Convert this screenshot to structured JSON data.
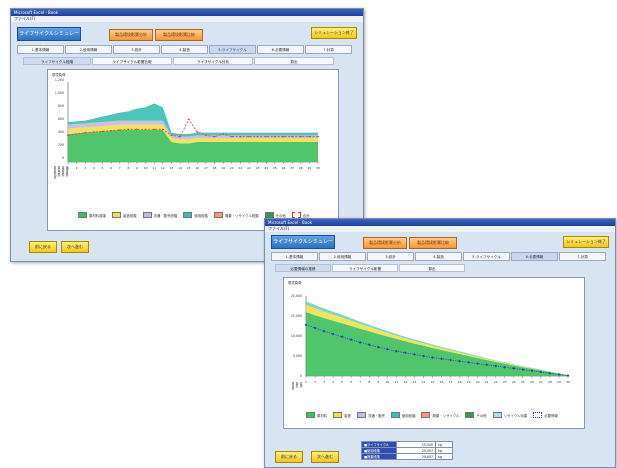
{
  "window1": {
    "title": "Microsoft Excel - Book",
    "menu": "ファイル(F)",
    "app_button": "ライフサイクルシミュレーション",
    "mid_buttons": [
      "製品環境影響分析",
      "製品環境影響比較"
    ],
    "right_button": "シミュレーション終了",
    "tabs": [
      "1.基本情報",
      "2.使用情報",
      "3.設計",
      "4.製造",
      "5.ライフサイクル",
      "6.必要情報",
      "7.計算"
    ],
    "active_tab": 4,
    "subtabs": [
      "ライフサイクル段階",
      "ライフサイクル影響比較",
      "ライフサイクル分析",
      "算出"
    ],
    "active_subtab": 0,
    "bottom_buttons": [
      "前に戻る",
      "次へ進む"
    ],
    "legend": [
      "原材料調達",
      "製造段階",
      "流通・販売段階",
      "使用段階",
      "廃棄・リサイクル段階",
      "その他",
      "合計"
    ],
    "ylabel": "環境負荷",
    "ytick_labels": [
      "1,200",
      "1,000",
      "800",
      "600",
      "400",
      "200",
      "0"
    ],
    "row_labels": [
      "原材料調達",
      "製造段階",
      "流通段階",
      "使用段階",
      "廃棄段階",
      "その他"
    ],
    "colors": {
      "green": "#3dbf5c",
      "yellow": "#f0e14a",
      "lavender": "#c8b6e6",
      "teal": "#36c0b2",
      "total": "#e23a3a"
    }
  },
  "window2": {
    "title": "Microsoft Excel - Book",
    "menu": "ファイル(F)",
    "app_button": "ライフサイクルシミュレーション",
    "mid_buttons": [
      "製品環境影響分析",
      "製品環境影響比較"
    ],
    "right_button": "シミュレーション終了",
    "tabs": [
      "1.基本情報",
      "2.使用情報",
      "3.設計",
      "4.製造",
      "5.ライフサイクル",
      "6.必要情報",
      "7.計算"
    ],
    "active_tab": 5,
    "subtabs": [
      "必要情報の推移",
      "ライフサイクル影響",
      "算出"
    ],
    "active_subtab": 0,
    "bottom_buttons": [
      "前に戻る",
      "次へ進む"
    ],
    "legend": [
      "原材料",
      "製造",
      "流通・販売",
      "使用段階",
      "廃棄・リサイクル",
      "その他",
      "リサイクル効果",
      "必要情報"
    ],
    "ylabel": "環境負荷",
    "ytick_labels": [
      "20,000",
      "15,000",
      "10,000",
      "5,000",
      "0"
    ],
    "row_labels": [
      "原材料",
      "製造",
      "流通",
      "使用",
      "廃棄",
      "その他"
    ],
    "summary": [
      {
        "label": "■ライフサイクル",
        "value": "15,000",
        "unit": "kg"
      },
      {
        "label": "■使用段階",
        "value": "20,007",
        "unit": "kg"
      },
      {
        "label": "■廃棄段階",
        "value": "20,007",
        "unit": "kg"
      }
    ],
    "colors": {
      "green": "#3dbf5c",
      "yellow": "#f0e14a",
      "teal": "#6fd3c4",
      "trend": "#2a3fc0"
    }
  },
  "chart_data": [
    {
      "type": "area",
      "title": "",
      "xlabel": "",
      "ylabel": "環境負荷",
      "ylim": [
        0,
        1200
      ],
      "x": [
        1,
        2,
        3,
        4,
        5,
        6,
        7,
        8,
        9,
        10,
        11,
        12,
        13,
        14,
        15,
        16,
        17,
        18,
        19,
        20,
        21,
        22,
        23,
        24,
        25,
        26,
        27,
        28,
        29,
        30
      ],
      "series": [
        {
          "name": "原材料調達",
          "values": [
            420,
            430,
            440,
            450,
            460,
            470,
            480,
            480,
            480,
            480,
            480,
            480,
            300,
            280,
            280,
            300,
            300,
            300,
            300,
            300,
            300,
            300,
            300,
            300,
            300,
            300,
            300,
            300,
            300,
            300
          ]
        },
        {
          "name": "製造段階",
          "values": [
            80,
            80,
            80,
            80,
            80,
            80,
            80,
            80,
            80,
            80,
            80,
            80,
            60,
            60,
            60,
            60,
            60,
            60,
            60,
            60,
            60,
            60,
            60,
            60,
            60,
            60,
            60,
            60,
            60,
            60
          ]
        },
        {
          "name": "流通・販売段階",
          "values": [
            60,
            60,
            60,
            60,
            60,
            60,
            60,
            60,
            60,
            60,
            60,
            60,
            40,
            40,
            40,
            40,
            40,
            40,
            40,
            40,
            40,
            40,
            40,
            40,
            40,
            40,
            40,
            40,
            40,
            40
          ]
        },
        {
          "name": "使用段階",
          "values": [
            40,
            40,
            40,
            60,
            80,
            100,
            120,
            140,
            180,
            200,
            260,
            200,
            40,
            40,
            40,
            40,
            40,
            40,
            40,
            40,
            40,
            40,
            40,
            40,
            40,
            40,
            40,
            40,
            40,
            40
          ]
        },
        {
          "name": "合計",
          "values": [
            400,
            420,
            440,
            450,
            460,
            470,
            480,
            490,
            490,
            490,
            490,
            490,
            400,
            380,
            640,
            450,
            400,
            380,
            420,
            380,
            380,
            380,
            380,
            380,
            380,
            380,
            380,
            380,
            380,
            380
          ]
        }
      ],
      "grid": false,
      "legend_position": "bottom"
    },
    {
      "type": "area",
      "title": "",
      "xlabel": "",
      "ylabel": "環境負荷",
      "ylim": [
        0,
        20000
      ],
      "x": [
        1,
        2,
        3,
        4,
        5,
        6,
        7,
        8,
        9,
        10,
        11,
        12,
        13,
        14,
        15,
        16,
        17,
        18,
        19,
        20,
        21,
        22,
        23,
        24,
        25,
        26,
        27,
        28,
        29,
        30
      ],
      "series": [
        {
          "name": "原材料",
          "values": [
            16000,
            15200,
            14500,
            13800,
            13200,
            12500,
            11800,
            11200,
            10500,
            9900,
            9300,
            8700,
            8100,
            7600,
            7000,
            6500,
            6000,
            5500,
            5000,
            4500,
            4000,
            3500,
            3100,
            2600,
            2200,
            1800,
            1400,
            1000,
            600,
            200
          ]
        },
        {
          "name": "製造",
          "values": [
            1800,
            1700,
            1600,
            1500,
            1400,
            1300,
            1200,
            1100,
            1000,
            900,
            800,
            700,
            650,
            600,
            550,
            500,
            450,
            400,
            350,
            300,
            250,
            200,
            180,
            160,
            140,
            120,
            100,
            80,
            60,
            40
          ]
        },
        {
          "name": "流通・販売",
          "values": [
            900,
            850,
            800,
            750,
            700,
            650,
            600,
            550,
            500,
            450,
            400,
            380,
            360,
            340,
            320,
            300,
            280,
            260,
            240,
            220,
            200,
            180,
            160,
            140,
            120,
            100,
            80,
            60,
            40,
            20
          ]
        },
        {
          "name": "必要情報",
          "values": [
            12800,
            12000,
            11200,
            10500,
            9800,
            9100,
            8400,
            7800,
            7200,
            6700,
            6200,
            5800,
            5400,
            5000,
            4600,
            4300,
            4000,
            3700,
            3400,
            3100,
            2800,
            2500,
            2200,
            1900,
            1600,
            1300,
            1000,
            700,
            400,
            100
          ]
        }
      ],
      "grid": false,
      "legend_position": "bottom"
    }
  ]
}
